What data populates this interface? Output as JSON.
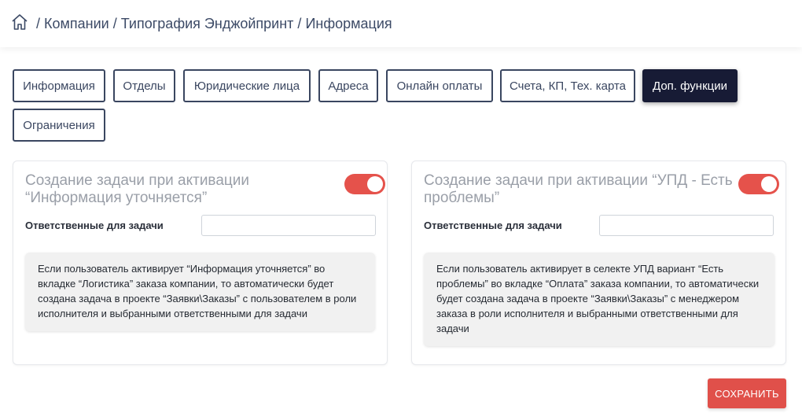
{
  "breadcrumb": {
    "items": [
      "Компании",
      "Типография Энджойпринт",
      "Информация"
    ],
    "separator": "/"
  },
  "tabs": [
    {
      "label": "Информация",
      "active": false
    },
    {
      "label": "Отделы",
      "active": false
    },
    {
      "label": "Юридические лица",
      "active": false
    },
    {
      "label": "Адреса",
      "active": false
    },
    {
      "label": "Онлайн оплаты",
      "active": false
    },
    {
      "label": "Счета, КП, Тех. карта",
      "active": false
    },
    {
      "label": "Доп. функции",
      "active": true
    },
    {
      "label": "Ограничения",
      "active": false
    }
  ],
  "cards": [
    {
      "title": "Создание задачи при активации “Информация уточняется”",
      "toggle_on": true,
      "field_label": "Ответственные для задачи",
      "field_value": "",
      "info": "Если пользователь активирует “Информация уточняется” во вкладке “Логистика” заказа компании, то автоматически будет создана задача в проекте “Заявки\\Заказы” с пользователем в роли исполнителя и выбранными ответственными для задачи"
    },
    {
      "title": "Создание задачи при активации “УПД - Есть проблемы”",
      "toggle_on": true,
      "field_label": "Ответственные для задачи",
      "field_value": "",
      "info": "Если пользователь активирует в селекте УПД вариант “Есть проблемы” во вкладке “Оплата” заказа компании, то автоматически будет создана задача в проекте “Заявки\\Заказы” с менеджером заказа в роли исполнителя и выбранными ответственными для задачи"
    }
  ],
  "save_label": "СОХРАНИТЬ",
  "colors": {
    "accent_red": "#e0504a",
    "active_tab": "#171b35",
    "tab_border": "#3a4660",
    "title_grey": "#9a9fa8"
  },
  "icons": {
    "home": "home-icon"
  }
}
